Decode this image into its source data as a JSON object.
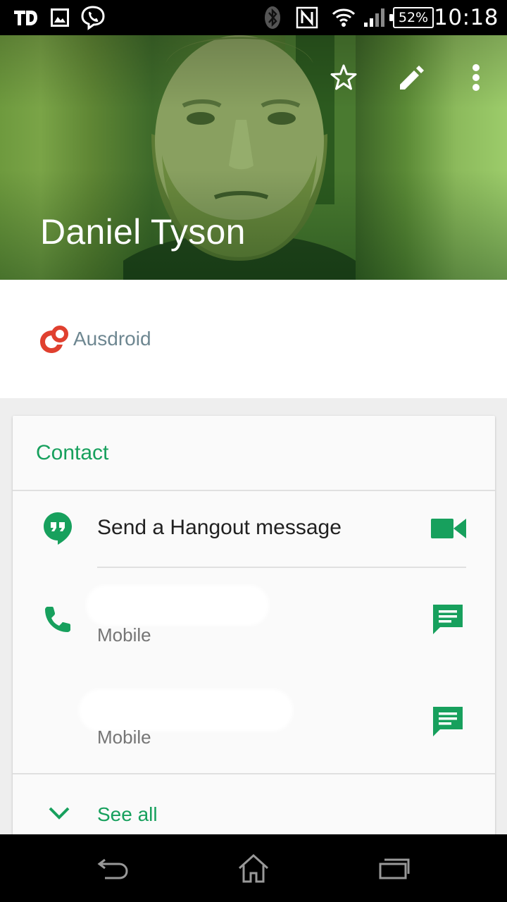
{
  "status_bar": {
    "time": "10:18",
    "battery": "52%",
    "left_icons": [
      "carrier-logo-icon",
      "image-notification-icon",
      "viber-icon"
    ],
    "right_icons": [
      "bluetooth-icon",
      "nfc-icon",
      "wifi-icon",
      "signal-icon",
      "battery-icon"
    ]
  },
  "header": {
    "name": "Daniel Tyson",
    "actions": [
      "star-icon",
      "edit-icon",
      "more-vert-icon"
    ]
  },
  "account": {
    "label": "Ausdroid"
  },
  "card": {
    "title": "Contact",
    "hangout": {
      "label": "Send a Hangout message"
    },
    "phones": [
      {
        "type": "Mobile"
      },
      {
        "type": "Mobile"
      }
    ],
    "see_all": "See all"
  },
  "colors": {
    "accent": "#17a05d",
    "account_text": "#6e8791",
    "account_logo": "#e0402f"
  }
}
